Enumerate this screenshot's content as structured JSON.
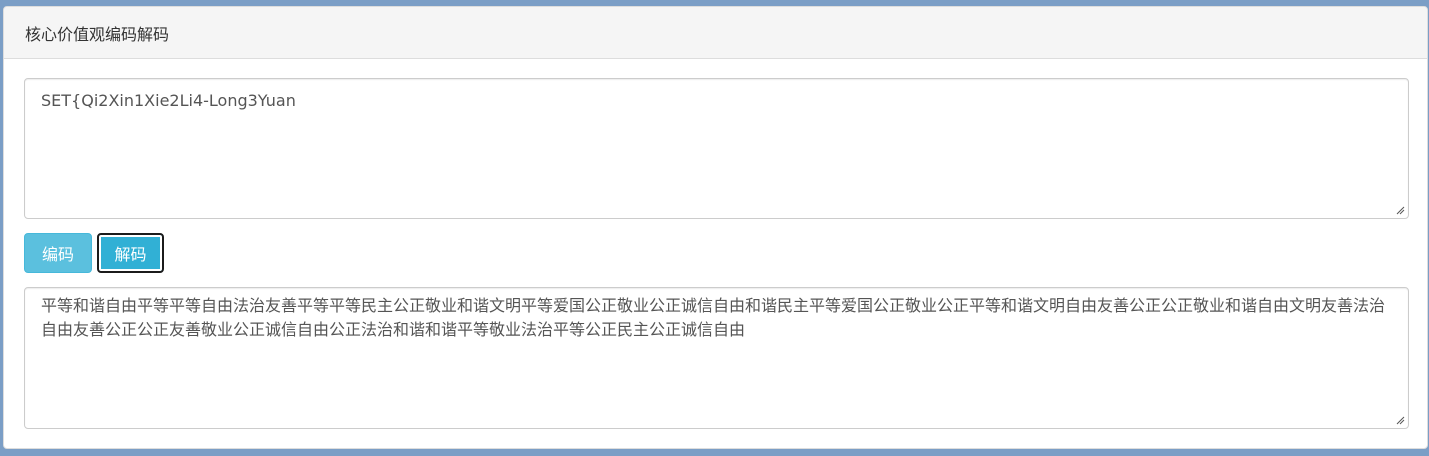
{
  "panel": {
    "title": "核心价值观编码解码"
  },
  "input": {
    "value": "SET{Qi2Xin1Xie2Li4-Long3Yuan"
  },
  "buttons": {
    "encode_label": "编码",
    "decode_label": "解码"
  },
  "output": {
    "value": "平等和谐自由平等平等自由法治友善平等平等民主公正敬业和谐文明平等爱国公正敬业公正诚信自由和谐民主平等爱国公正敬业公正平等和谐文明自由友善公正公正敬业和谐自由文明友善法治自由友善公正公正友善敬业公正诚信自由公正法治和谐和谐平等敬业法治平等公正民主公正诚信自由"
  },
  "colors": {
    "page_background": "#7b9ec6",
    "button_info": "#5bc0de",
    "button_info_active": "#31b0d5"
  }
}
